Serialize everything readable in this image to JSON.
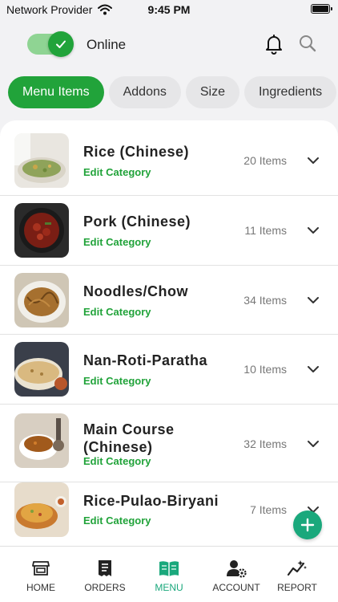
{
  "status_bar": {
    "carrier": "Network Provider",
    "time": "9:45 PM"
  },
  "topbar": {
    "online_label": "Online",
    "icons": [
      "bell-icon",
      "search-icon"
    ],
    "toggle_on": true
  },
  "chips": [
    {
      "label": "Menu Items",
      "active": true
    },
    {
      "label": "Addons",
      "active": false
    },
    {
      "label": "Size",
      "active": false
    },
    {
      "label": "Ingredients",
      "active": false
    }
  ],
  "categories": [
    {
      "title": "Rice (Chinese)",
      "edit_label": "Edit Category",
      "count": "20 Items"
    },
    {
      "title": "Pork (Chinese)",
      "edit_label": "Edit Category",
      "count": "11 Items"
    },
    {
      "title": "Noodles/Chow",
      "edit_label": "Edit Category",
      "count": "34 Items"
    },
    {
      "title": "Nan-Roti-Paratha",
      "edit_label": "Edit Category",
      "count": "10 Items"
    },
    {
      "title": "Main Course (Chinese)",
      "edit_label": "Edit Category",
      "count": "32 Items"
    },
    {
      "title": "Rice-Pulao-Biryani",
      "edit_label": "Edit Category",
      "count": "7 Items"
    }
  ],
  "bottom_nav": [
    {
      "label": "HOME",
      "icon": "store-icon",
      "active": false
    },
    {
      "label": "ORDERS",
      "icon": "receipt-icon",
      "active": false
    },
    {
      "label": "MENU",
      "icon": "menu-book-icon",
      "active": true
    },
    {
      "label": "ACCOUNT",
      "icon": "account-gear-icon",
      "active": false
    },
    {
      "label": "REPORT",
      "icon": "report-chart-icon",
      "active": false
    }
  ],
  "colors": {
    "accent": "#21a33a",
    "teal": "#1aa87c",
    "background": "#f2f2f4"
  }
}
